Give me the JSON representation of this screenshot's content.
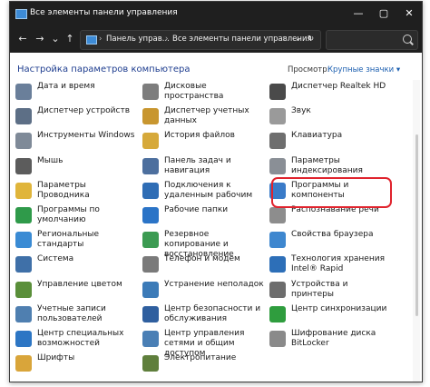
{
  "window": {
    "title": "Все элементы панели управления",
    "controls": {
      "minimize": "—",
      "maximize": "▢",
      "close": "✕"
    }
  },
  "address_bar": {
    "crumbs": [
      "Панель управ...",
      "Все элементы панели управления"
    ],
    "nav": {
      "back": "←",
      "forward": "→",
      "down": "⌄",
      "up": "↑",
      "dropdown": "⌄",
      "refresh": "↻"
    }
  },
  "header": {
    "title": "Настройка параметров компьютера",
    "view_label": "Просмотр:",
    "view_value": "Крупные значки ▾"
  },
  "items": [
    {
      "label": "Дата и время",
      "icon": "clock-icon",
      "color": "#6a7f9a"
    },
    {
      "label": "Дисковые пространства",
      "icon": "storage-icon",
      "color": "#7d7d7d"
    },
    {
      "label": "Диспетчер Realtek HD",
      "icon": "speaker-icon",
      "color": "#4a4a4a"
    },
    {
      "label": "Диспетчер устройств",
      "icon": "device-manager-icon",
      "color": "#5d6f86"
    },
    {
      "label": "Диспетчер учетных данных",
      "icon": "credentials-icon",
      "color": "#c8962f"
    },
    {
      "label": "Звук",
      "icon": "sound-icon",
      "color": "#9a9a9a"
    },
    {
      "label": "Инструменты Windows",
      "icon": "tools-icon",
      "color": "#7f8a98"
    },
    {
      "label": "История файлов",
      "icon": "file-history-icon",
      "color": "#d6a93a"
    },
    {
      "label": "Клавиатура",
      "icon": "keyboard-icon",
      "color": "#6e6e6e"
    },
    {
      "label": "Мышь",
      "icon": "mouse-icon",
      "color": "#5c5c5c"
    },
    {
      "label": "Панель задач и навигация",
      "icon": "taskbar-icon",
      "color": "#4d6f9e"
    },
    {
      "label": "Параметры индексирования",
      "icon": "indexing-icon",
      "color": "#8a8f96"
    },
    {
      "label": "Параметры Проводника",
      "icon": "folder-options-icon",
      "color": "#e0b53b"
    },
    {
      "label": "Подключения к удаленным рабочим",
      "icon": "remote-desktop-icon",
      "color": "#2f6db5"
    },
    {
      "label": "Программы и компоненты",
      "icon": "programs-icon",
      "color": "#3a7bc8"
    },
    {
      "label": "Программы по умолчанию",
      "icon": "default-programs-icon",
      "color": "#2f9a4a"
    },
    {
      "label": "Рабочие папки",
      "icon": "work-folders-icon",
      "color": "#2b74c7"
    },
    {
      "label": "Распознавание речи",
      "icon": "microphone-icon",
      "color": "#8d8d8d"
    },
    {
      "label": "Региональные стандарты",
      "icon": "region-icon",
      "color": "#3a8bd4"
    },
    {
      "label": "Резервное копирование и восстановление",
      "icon": "backup-icon",
      "color": "#3c9b52"
    },
    {
      "label": "Свойства браузера",
      "icon": "browser-icon",
      "color": "#3e87cf"
    },
    {
      "label": "Система",
      "icon": "system-icon",
      "color": "#3f70a8"
    },
    {
      "label": "Телефон и модем",
      "icon": "phone-icon",
      "color": "#7a7a7a"
    },
    {
      "label": "Технология хранения Intel® Rapid",
      "icon": "intel-icon",
      "color": "#2d6fb8"
    },
    {
      "label": "Управление цветом",
      "icon": "color-icon",
      "color": "#5a8f3a"
    },
    {
      "label": "Устранение неполадок",
      "icon": "troubleshoot-icon",
      "color": "#3c7bb8"
    },
    {
      "label": "Устройства и принтеры",
      "icon": "printer-icon",
      "color": "#6d6d6d"
    },
    {
      "label": "Учетные записи пользователей",
      "icon": "user-accounts-icon",
      "color": "#4f7fb0"
    },
    {
      "label": "Центр безопасности и обслуживания",
      "icon": "security-flag-icon",
      "color": "#2f5f9f"
    },
    {
      "label": "Центр синхронизации",
      "icon": "sync-icon",
      "color": "#2f9d3e"
    },
    {
      "label": "Центр специальных возможностей",
      "icon": "accessibility-icon",
      "color": "#2d76c4"
    },
    {
      "label": "Центр управления сетями и общим доступом",
      "icon": "network-icon",
      "color": "#4a7fb5"
    },
    {
      "label": "Шифрование диска BitLocker",
      "icon": "bitlocker-icon",
      "color": "#8a8a8a"
    },
    {
      "label": "Шрифты",
      "icon": "fonts-icon",
      "color": "#d9a53a"
    },
    {
      "label": "Электропитание",
      "icon": "power-icon",
      "color": "#5f7f3c"
    }
  ],
  "highlighted_item": "Программы и компоненты"
}
